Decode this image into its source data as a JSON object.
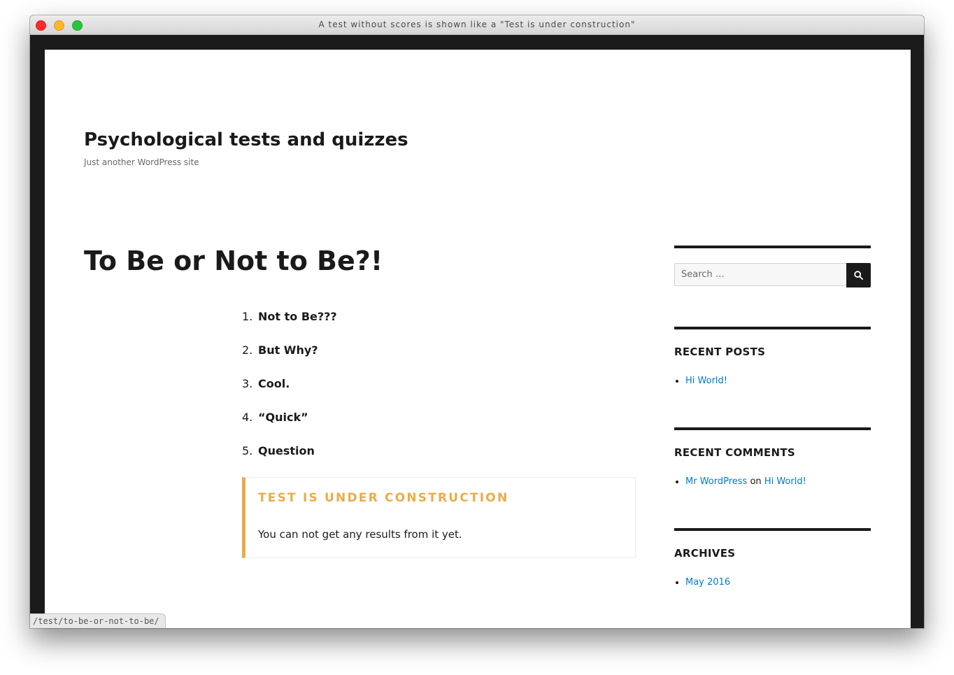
{
  "window": {
    "title": "A test without scores is shown like a \"Test is under construction\""
  },
  "site": {
    "title": "Psychological tests and quizzes",
    "description": "Just another WordPress site"
  },
  "entry": {
    "title": "To Be or Not to Be?!",
    "questions": [
      {
        "number": "1.",
        "text": "Not to Be???"
      },
      {
        "number": "2.",
        "text": "But Why?"
      },
      {
        "number": "3.",
        "text": "Cool."
      },
      {
        "number": "4.",
        "text": "“Quick”"
      },
      {
        "number": "5.",
        "text": "Question"
      }
    ],
    "notice": {
      "title": "TEST IS UNDER CONSTRUCTION",
      "text": "You can not get any results from it yet.",
      "accent_color": "#e9ac4a"
    }
  },
  "sidebar": {
    "search": {
      "placeholder": "Search …",
      "value": "",
      "button_icon": "search-icon"
    },
    "recent_posts": {
      "title": "RECENT POSTS",
      "items": [
        "Hi World!"
      ]
    },
    "recent_comments": {
      "title": "RECENT COMMENTS",
      "items": [
        {
          "author": "Mr WordPress",
          "connector": "on",
          "post": "Hi World!"
        }
      ]
    },
    "archives": {
      "title": "ARCHIVES",
      "items": [
        "May 2016"
      ]
    }
  },
  "status_bar": {
    "url": "/test/to-be-or-not-to-be/"
  },
  "colors": {
    "link": "#007acc",
    "text": "#1a1a1a",
    "frame": "#1b1b1b"
  }
}
